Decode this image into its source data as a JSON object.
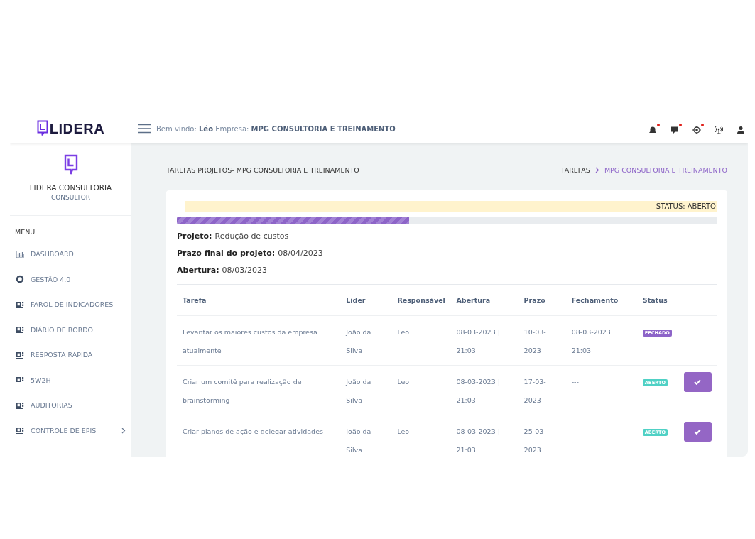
{
  "header": {
    "logo": "LIDERA",
    "welcome_label": "Bem vindo:",
    "user": "Léo",
    "company_label": "Empresa:",
    "company": "MPG CONSULTORIA E TREINAMENTO",
    "icons": [
      {
        "kind": "bell",
        "notification": true
      },
      {
        "kind": "chat",
        "notification": true
      },
      {
        "kind": "target",
        "notification": true
      },
      {
        "kind": "antenna",
        "notification": false
      },
      {
        "kind": "user",
        "notification": false
      }
    ]
  },
  "sidebar": {
    "profile_name": "LIDERA CONSULTORIA",
    "profile_role": "CONSULTOR",
    "menu_title": "MENU",
    "items": [
      {
        "label": "DASHBOARD",
        "kind": "chart",
        "expandable": false
      },
      {
        "label": "GESTÃO 4.0",
        "kind": "circle",
        "expandable": false
      },
      {
        "label": "FAROL DE INDICADORES",
        "kind": "widget",
        "expandable": false
      },
      {
        "label": "DIÁRIO DE BORDO",
        "kind": "widget",
        "expandable": false
      },
      {
        "label": "RESPOSTA RÁPIDA",
        "kind": "widget",
        "expandable": false
      },
      {
        "label": "5W2H",
        "kind": "widget",
        "expandable": false
      },
      {
        "label": "AUDITORIAS",
        "kind": "widget",
        "expandable": false
      },
      {
        "label": "CONTROLE DE EPIS",
        "kind": "widget",
        "expandable": true
      }
    ]
  },
  "page": {
    "title": "TAREFAS PROJETOS- MPG CONSULTORIA E TREINAMENTO",
    "breadcrumb": [
      {
        "label": "TAREFAS",
        "selected": false
      },
      {
        "label": "MPG CONSULTORIA E TREINAMENTO",
        "selected": true
      }
    ]
  },
  "project": {
    "status": "STATUS: ABERTO",
    "level": 0.43,
    "fields": [
      {
        "label": "Projeto:",
        "value": "Redução de custos"
      },
      {
        "label": "Prazo final do projeto:",
        "value": "08/04/2023"
      },
      {
        "label": "Abertura:",
        "value": "08/03/2023"
      }
    ]
  },
  "table": {
    "columns": [
      "Tarefa",
      "Líder",
      "Responsável",
      "Abertura",
      "Prazo",
      "Fechamento",
      "Status"
    ],
    "rows": [
      {
        "tarefa": "Levantar os maiores custos da empresa atualmente",
        "lider": "João da Silva",
        "responsavel": "Leo",
        "abertura": "08-03-2023 | 21:03",
        "prazo": "10-03-2023",
        "fechamento": "08-03-2023 | 21:03",
        "status": {
          "label": "FECHADO",
          "color": "#8d64c8"
        },
        "confirm_button": false
      },
      {
        "tarefa": "Criar um comitê para realização de brainstorming",
        "lider": "João da Silva",
        "responsavel": "Leo",
        "abertura": "08-03-2023 | 21:03",
        "prazo": "17-03-2023",
        "fechamento": "---",
        "status": {
          "label": "ABERTO",
          "color": "#4fd1c5"
        },
        "confirm_button": true
      },
      {
        "tarefa": "Criar planos de ação e delegar atividades",
        "lider": "João da Silva",
        "responsavel": "Leo",
        "abertura": "08-03-2023 | 21:03",
        "prazo": "25-03-2023",
        "fechamento": "---",
        "status": {
          "label": "ABERTO",
          "color": "#4fd1c5"
        },
        "confirm_button": true
      }
    ]
  }
}
